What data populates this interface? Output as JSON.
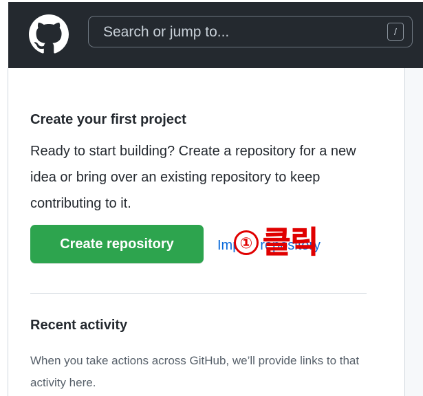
{
  "header": {
    "logo_icon": "github-mark-icon",
    "search_placeholder": "Search or jump to...",
    "search_shortcut": "/"
  },
  "project": {
    "title": "Create your first project",
    "description": "Ready to start building? Create a repository for a new idea or bring over an existing repository to keep contributing to it.",
    "create_button": "Create repository",
    "import_link": "Import repository"
  },
  "annotation": {
    "number": "①",
    "text": "클릭",
    "color": "#e00000"
  },
  "recent": {
    "title": "Recent activity",
    "description": "When you take actions across GitHub, we’ll provide links to that activity here."
  },
  "colors": {
    "header_bg": "#24292f",
    "primary_button": "#2da44e",
    "link": "#0969da"
  }
}
